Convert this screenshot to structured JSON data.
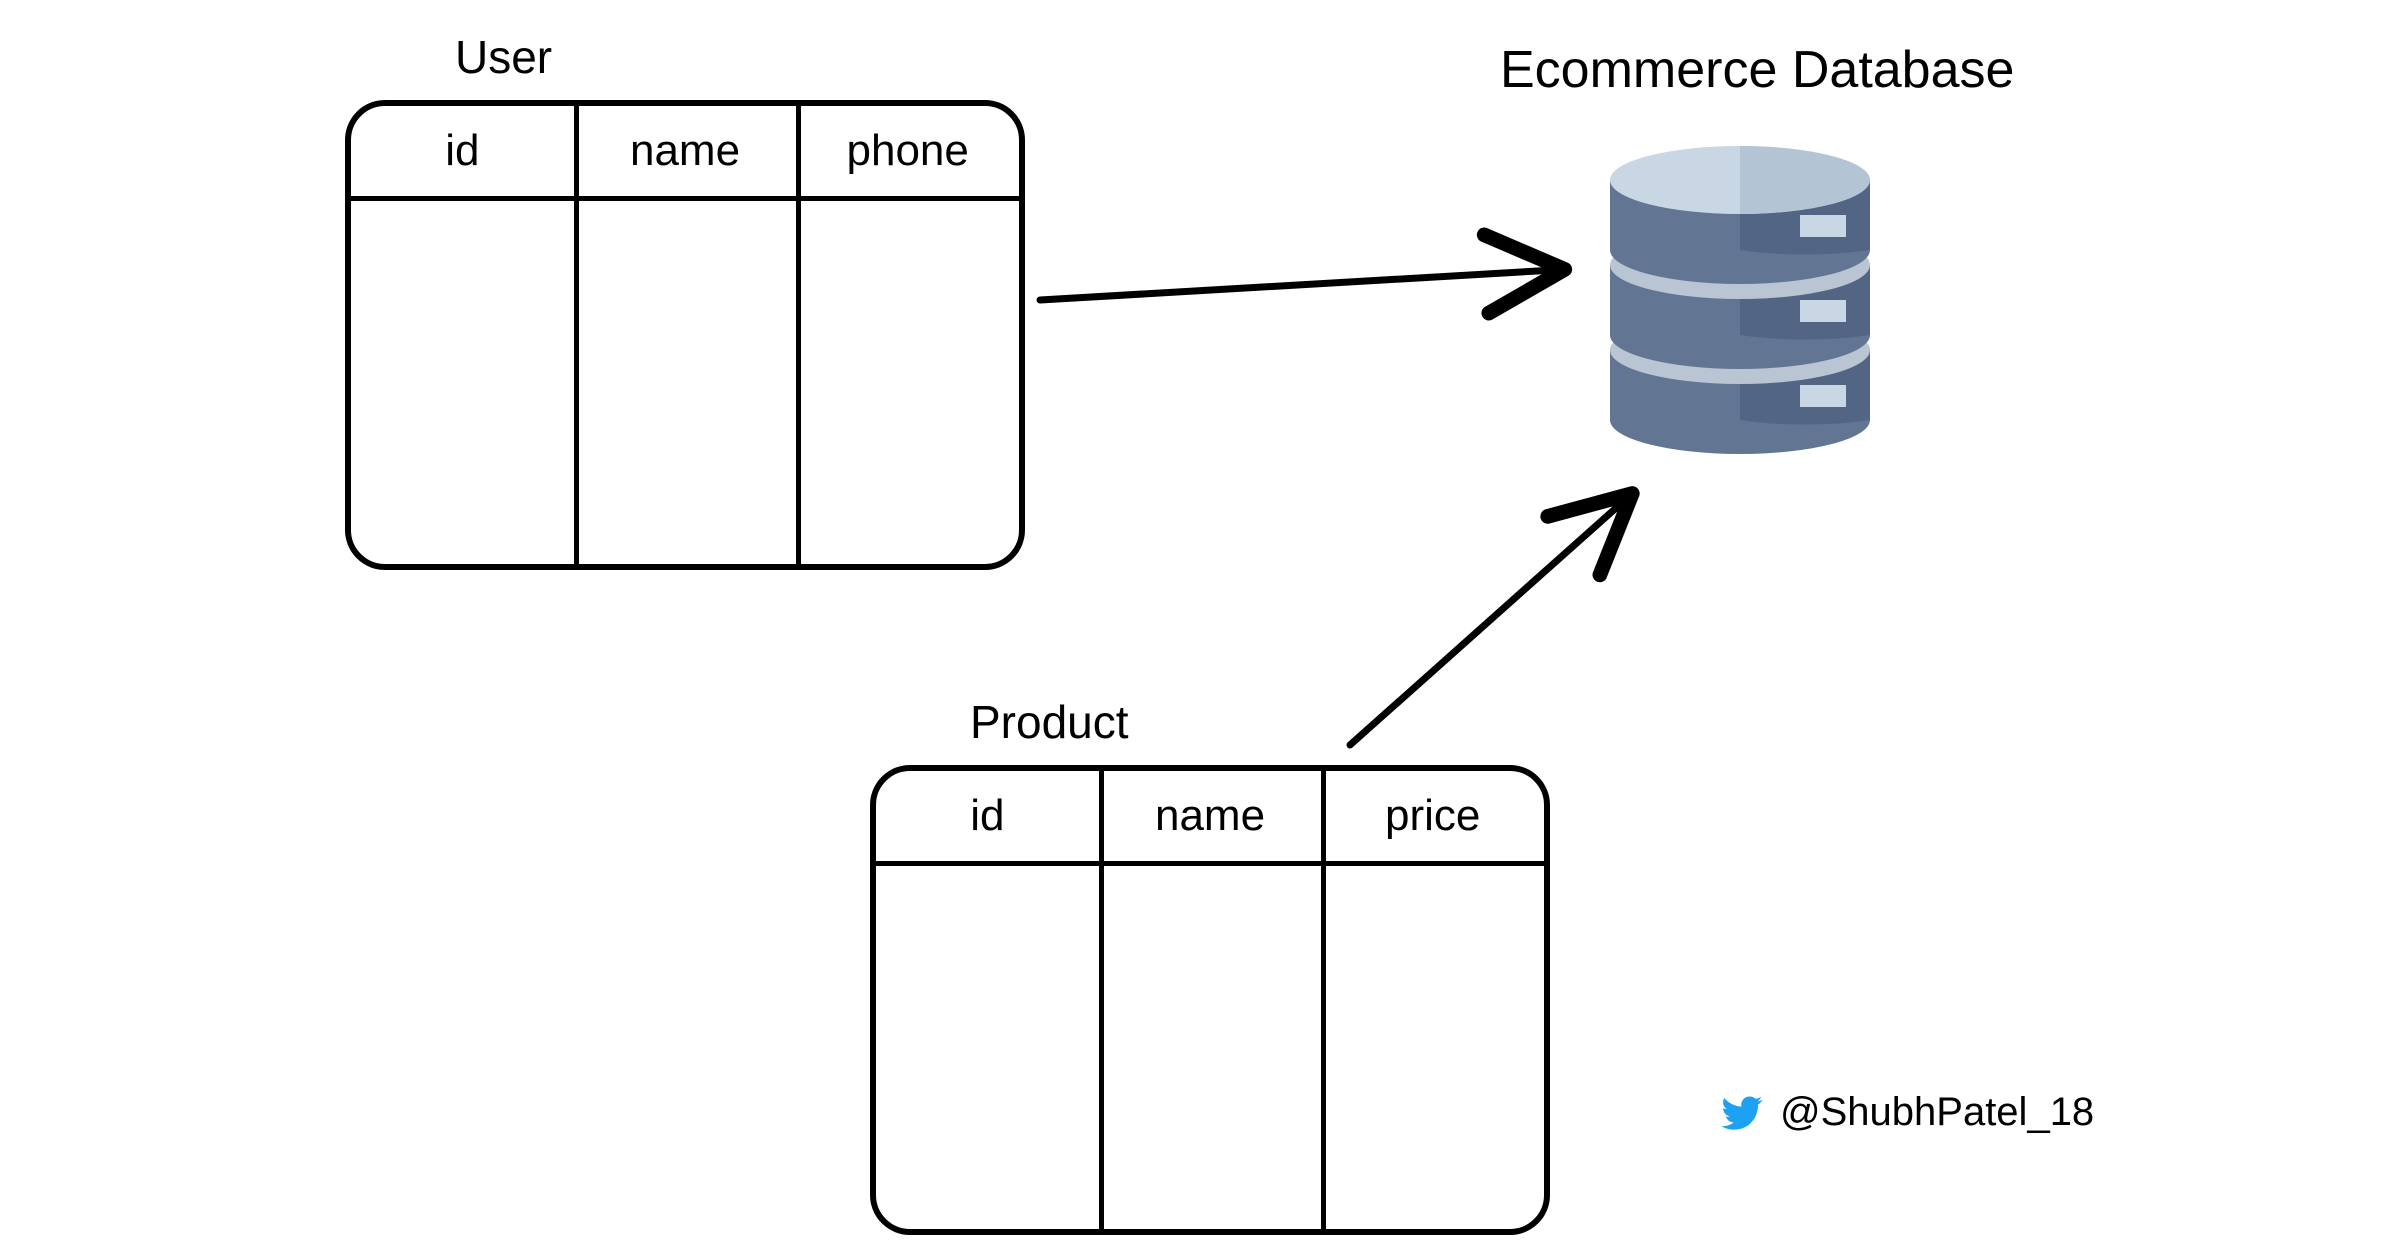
{
  "tables": {
    "user": {
      "title": "User",
      "columns": [
        "id",
        "name",
        "phone"
      ]
    },
    "product": {
      "title": "Product",
      "columns": [
        "id",
        "name",
        "price"
      ]
    }
  },
  "database": {
    "title": "Ecommerce Database",
    "colors": {
      "light_top": "#c9d6e3",
      "light_top_shade": "#b3c4d5",
      "body_left": "#627693",
      "body_right": "#526584",
      "gap": "#b9c5d3",
      "slot": "#c9d6e3"
    }
  },
  "arrows": {
    "stroke": "#000000",
    "width": 7
  },
  "credit": {
    "icon": "twitter-icon",
    "handle": "@ShubhPatel_18",
    "icon_color": "#1DA1F2"
  }
}
